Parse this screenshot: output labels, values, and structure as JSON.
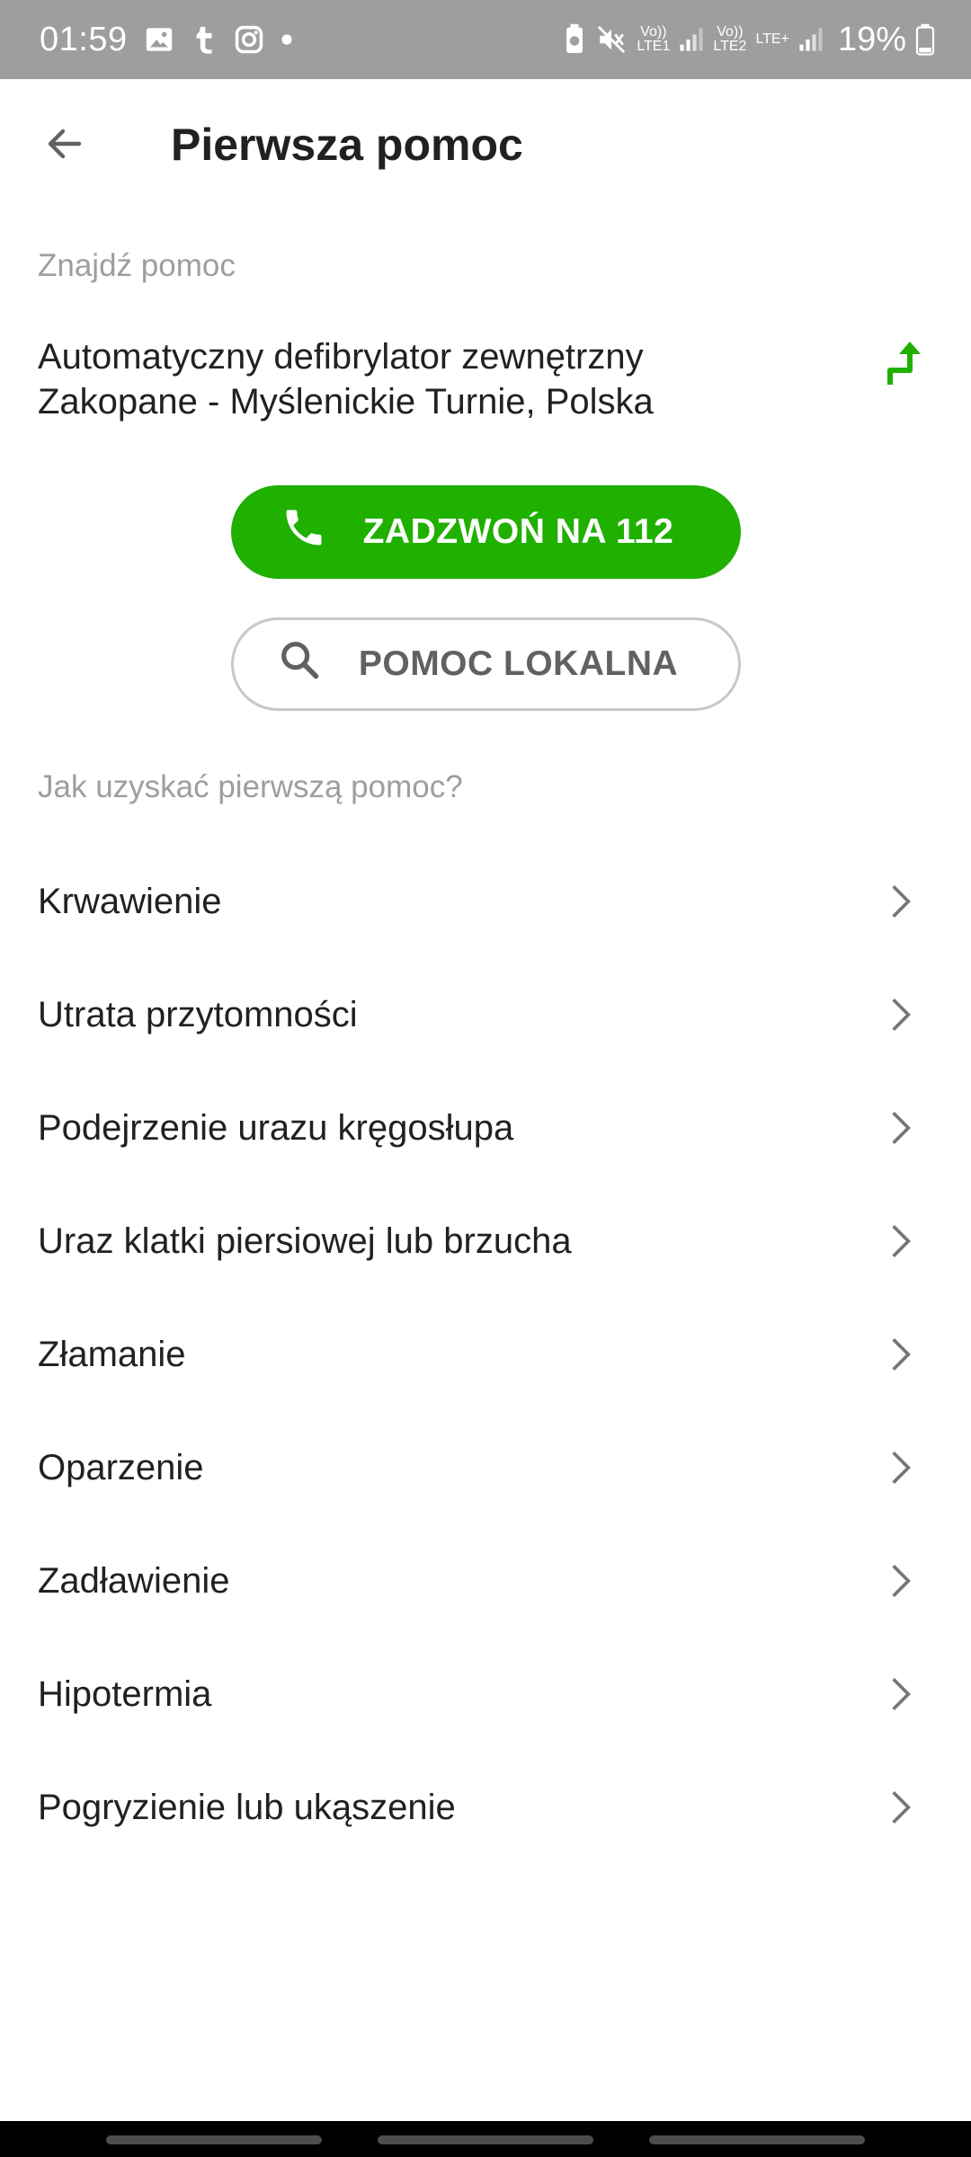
{
  "status_bar": {
    "time": "01:59",
    "sim1_label_top": "Vo))",
    "sim1_label_bottom": "LTE1",
    "sim2_label_top": "Vo))",
    "sim2_label_bottom": "LTE2",
    "sim2_network": "LTE+",
    "battery_percent": "19%",
    "icons": [
      "gallery-icon",
      "tumblr-icon",
      "instagram-icon",
      "dot-icon",
      "battery-saver-icon",
      "mute-icon",
      "signal-icon",
      "battery-icon"
    ]
  },
  "header": {
    "title": "Pierwsza pomoc"
  },
  "find_help": {
    "section_label": "Znajdź pomoc",
    "aed_line1": "Automatyczny defibrylator zewnętrzny",
    "aed_line2": "Zakopane - Myślenickie Turnie, Polska",
    "call_button_label": "ZADZWOŃ NA 112",
    "local_help_button_label": "POMOC LOKALNA"
  },
  "first_aid": {
    "section_label": "Jak uzyskać pierwszą pomoc?",
    "items": [
      {
        "label": "Krwawienie"
      },
      {
        "label": "Utrata przytomności"
      },
      {
        "label": "Podejrzenie urazu kręgosłupa"
      },
      {
        "label": "Uraz klatki piersiowej lub brzucha"
      },
      {
        "label": "Złamanie"
      },
      {
        "label": "Oparzenie"
      },
      {
        "label": "Zadławienie"
      },
      {
        "label": "Hipotermia"
      },
      {
        "label": "Pogryzienie lub ukąszenie"
      }
    ]
  },
  "colors": {
    "accent_green": "#20b000",
    "status_bar": "#9e9e9e",
    "muted_text": "#9e9e9e"
  }
}
